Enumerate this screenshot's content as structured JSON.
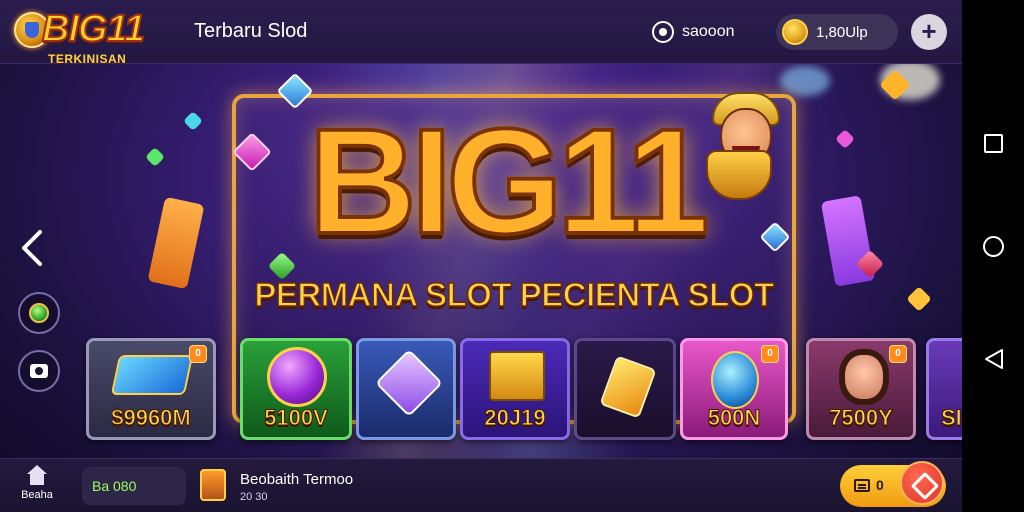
{
  "header": {
    "logo_text": "BIG11",
    "logo_subtext": "TERKINISAN",
    "title": "Terbaru Slod",
    "sound_label": "saooon",
    "balance": "1,80Ulp",
    "add_icon": "plus-icon"
  },
  "sidebar": {
    "back_icon": "chevron-left-icon",
    "buttons": [
      {
        "icon": "gem-icon"
      },
      {
        "icon": "camera-icon"
      }
    ]
  },
  "banner": {
    "title": "BIG11",
    "tagline": "PERMANA SLOT PECIENTA SLOT"
  },
  "games": [
    {
      "label": "$9960M",
      "art": "card-box",
      "badge": "0"
    },
    {
      "label": "5100V",
      "art": "purple-orb"
    },
    {
      "label": "",
      "art": "crystal"
    },
    {
      "label": "20J19",
      "art": "gift-box"
    },
    {
      "label": "",
      "art": "gold-gem"
    },
    {
      "label": "500N",
      "art": "blue-egg",
      "badge": "0"
    },
    {
      "label": "7500Y",
      "art": "woman-portrait",
      "badge": "0"
    },
    {
      "label": "SI",
      "art": "partial"
    }
  ],
  "bottom": {
    "home_label": "Beaha",
    "credit_value": "Ba 080",
    "promo_title": "Beobaith Termoo",
    "promo_sub": "20 30",
    "pill_value": "0"
  },
  "colors": {
    "accent_gold": "#ffcf2e",
    "banner_border": "#e8a53a",
    "background": "#3a1f7a",
    "credit_green": "#9dff5a",
    "action_red": "#e0322a"
  }
}
